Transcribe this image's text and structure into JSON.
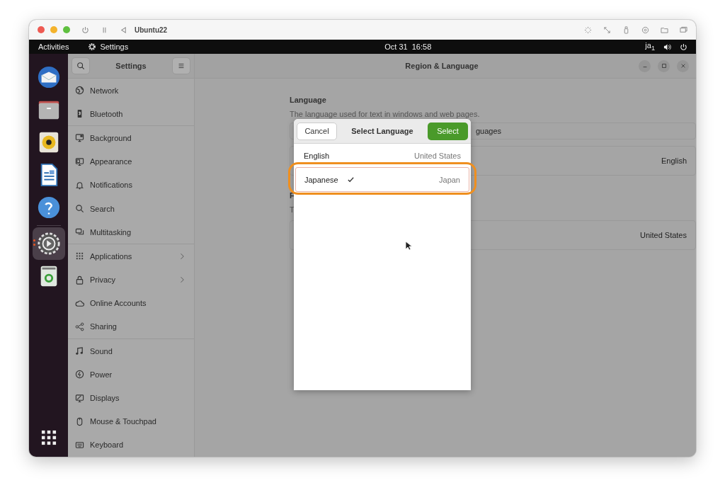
{
  "vm_window": {
    "title": "Ubuntu22"
  },
  "top_bar": {
    "activities": "Activities",
    "app": "Settings",
    "clock": "Oct 31  16:58",
    "input_method": "ja$_{1}$"
  },
  "dock": [
    {
      "selected": false
    },
    {
      "selected": false
    },
    {
      "selected": false
    },
    {
      "selected": false
    },
    {
      "selected": false
    },
    {
      "selected": true
    },
    {
      "selected": false
    }
  ],
  "sidebar": {
    "title": "Settings",
    "groups": [
      [
        {
          "label": "Network",
          "arrow": false
        },
        {
          "label": "Bluetooth",
          "arrow": false
        }
      ],
      [
        {
          "label": "Background",
          "arrow": false
        },
        {
          "label": "Appearance",
          "arrow": false
        },
        {
          "label": "Notifications",
          "arrow": false
        },
        {
          "label": "Search",
          "arrow": false
        },
        {
          "label": "Multitasking",
          "arrow": false
        }
      ],
      [
        {
          "label": "Applications",
          "arrow": true
        },
        {
          "label": "Privacy",
          "arrow": true
        },
        {
          "label": "Online Accounts",
          "arrow": false
        },
        {
          "label": "Sharing",
          "arrow": false
        }
      ],
      [
        {
          "label": "Sound",
          "arrow": false
        },
        {
          "label": "Power",
          "arrow": false
        },
        {
          "label": "Displays",
          "arrow": false
        },
        {
          "label": "Mouse & Touchpad",
          "arrow": false
        },
        {
          "label": "Keyboard",
          "arrow": false
        }
      ]
    ]
  },
  "main": {
    "title": "Region & Language",
    "language_heading": "Language",
    "language_description": "The language used for text in windows and web pages.",
    "manage_row_visible": "guages",
    "language_value": "English",
    "formats_heading_visible": "F",
    "formats_description_visible": "T",
    "formats_value": "United States"
  },
  "dialog": {
    "title": "Select Language",
    "cancel": "Cancel",
    "select": "Select",
    "languages": [
      {
        "name": "English",
        "region": "United States",
        "checked": false,
        "highlighted": false
      },
      {
        "name": "Japanese",
        "region": "Japan",
        "checked": true,
        "highlighted": true
      }
    ]
  }
}
